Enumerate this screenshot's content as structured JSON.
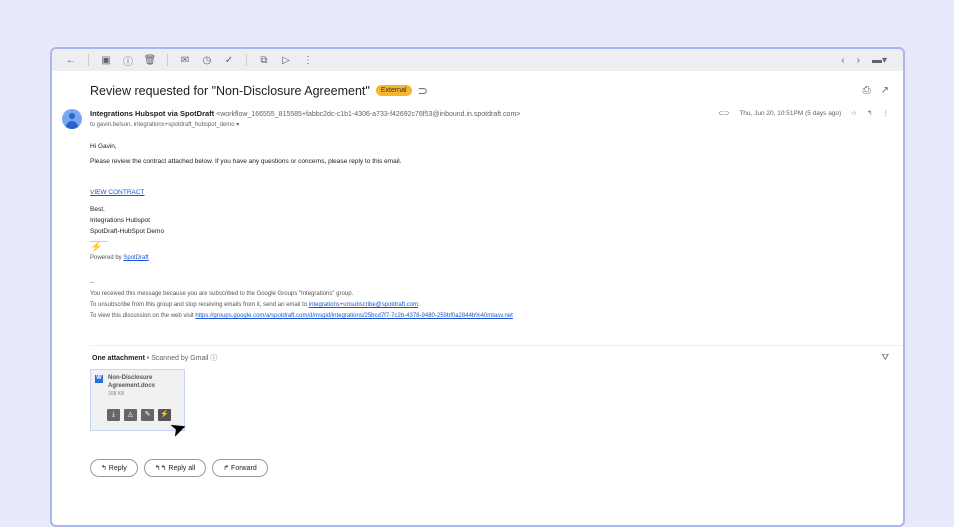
{
  "toolbar": {
    "back": "←",
    "archive": "▣",
    "spam": "ⓘ",
    "delete": "🗑",
    "unread": "✉",
    "snooze": "◷",
    "task": "✓",
    "move": "⧉",
    "label": "▷",
    "more": "⋮",
    "prev": "‹",
    "next": "›",
    "input": "▬▾"
  },
  "subject": "Review requested for \"Non-Disclosure Agreement\"",
  "badge": "External",
  "sender": {
    "name": "Integrations Hubspot via SpotDraft",
    "email": "<workflow_166555_815585+fabbc2dc-c1b1-4306-a733-f42692c76f53@inbound.in.spotdraft.com>",
    "to": "to gavin.belson, integrations+spotdraft_hubspot_demo ▾"
  },
  "date": "Thu, Jun 20, 10:51PM (5 days ago)",
  "body": {
    "greeting": "Hi Gavin,",
    "message": "Please review the contract attached below. If you have any questions or concerns, please reply to this email.",
    "link": "VIEW CONTRACT",
    "signoff": "Best,",
    "sig1": "Integrations Hubspot",
    "sig2": "SpotDraft-HubSpot Demo",
    "powered": "Powered by ",
    "powered_link": "SpotDraft"
  },
  "footer": {
    "dash": "--",
    "line1": "You received this message because you are subscribed to the Google Groups \"Integrations\" group.",
    "line2": "To unsubscribe from this group and stop receiving emails from it, send an email to ",
    "line2_link": "integrations+unsubscribe@spotdraft.com",
    "line3": "To view this discussion on the web visit ",
    "line3_link": "https://groups.google.com/a/spotdraft.com/d/msgid/integrations/25bcd7f7-7c2b-4378-9480-259bf0a2844b%40mtasv.net"
  },
  "attachments": {
    "header": "One attachment",
    "scanned": " • Scanned by Gmail ⓘ",
    "file": {
      "name": "Non-Disclosure Agreement.docx",
      "size": "308 KB"
    }
  },
  "actions": {
    "reply": "↰ Reply",
    "reply_all": "↰↰ Reply all",
    "forward": "↱ Forward"
  }
}
